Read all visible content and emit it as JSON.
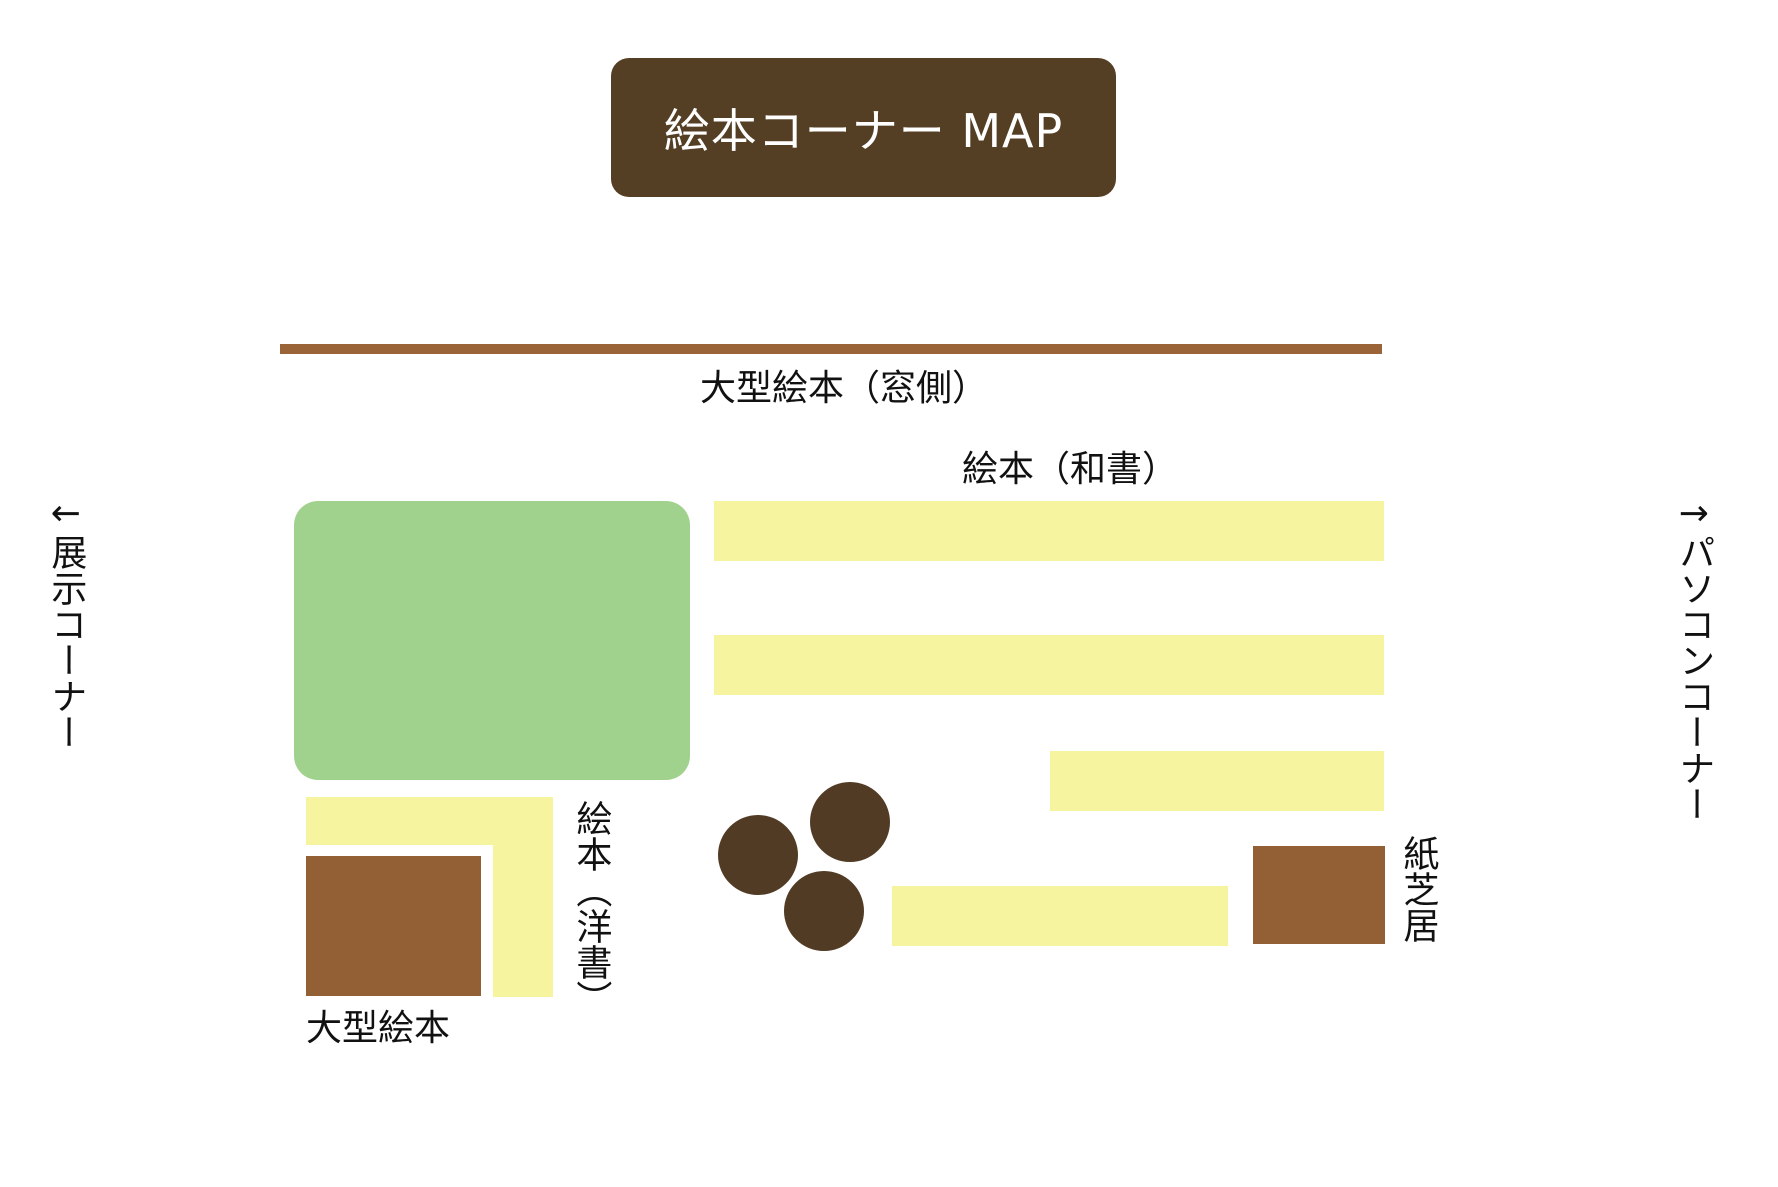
{
  "title": "絵本コーナー MAP",
  "labels": {
    "window_large_picture_books": "大型絵本（窓側）",
    "picture_books_japanese": "絵本（和書）",
    "picture_books_western": "絵本（洋書）",
    "large_picture_books": "大型絵本",
    "kamishibai": "紙芝居",
    "left_exit": "←展示コーナー",
    "right_exit": "→パソコンコーナー"
  },
  "colors": {
    "title_bg": "#543f24",
    "window_line": "#9b6438",
    "table": "#a1d28d",
    "shelf": "#f7f49f",
    "brown_box": "#935f35",
    "stool": "#513b24"
  }
}
